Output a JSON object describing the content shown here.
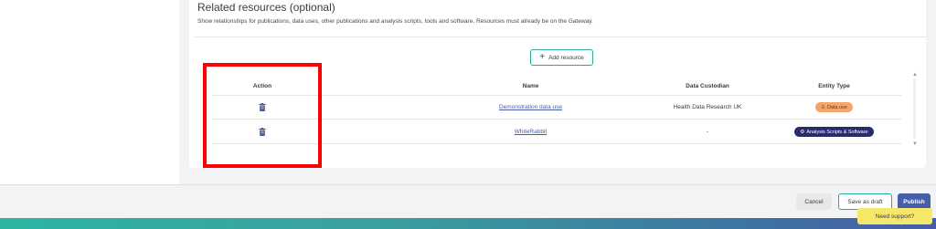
{
  "section": {
    "title": "Related resources (optional)",
    "description": "Show relationships for publications, data uses, other publications and analysis scripts, tools and software. Resources must already be on the Gateway."
  },
  "add_resource_label": "Add resource",
  "table": {
    "headers": [
      "Action",
      "Name",
      "Data Custodian",
      "Entity Type"
    ],
    "rows": [
      {
        "name": "Demonstration data use",
        "custodian": "Health Data Research UK",
        "entity_type": "Data use",
        "entity_icon": "people-icon"
      },
      {
        "name": "WhiteRabbit",
        "custodian": "-",
        "entity_type": "Analysis Scripts & Software",
        "entity_icon": "gears-icon"
      }
    ]
  },
  "footer": {
    "cancel_label": "Cancel",
    "draft_label": "Save as draft",
    "publish_label": "Publish"
  },
  "support_label": "Need support?",
  "colors": {
    "accent": "#2aa89a",
    "primary": "#475da7",
    "data_use_badge": "#f5a46a",
    "tools_badge": "#2a2a6e",
    "highlight": "#ff0000"
  }
}
